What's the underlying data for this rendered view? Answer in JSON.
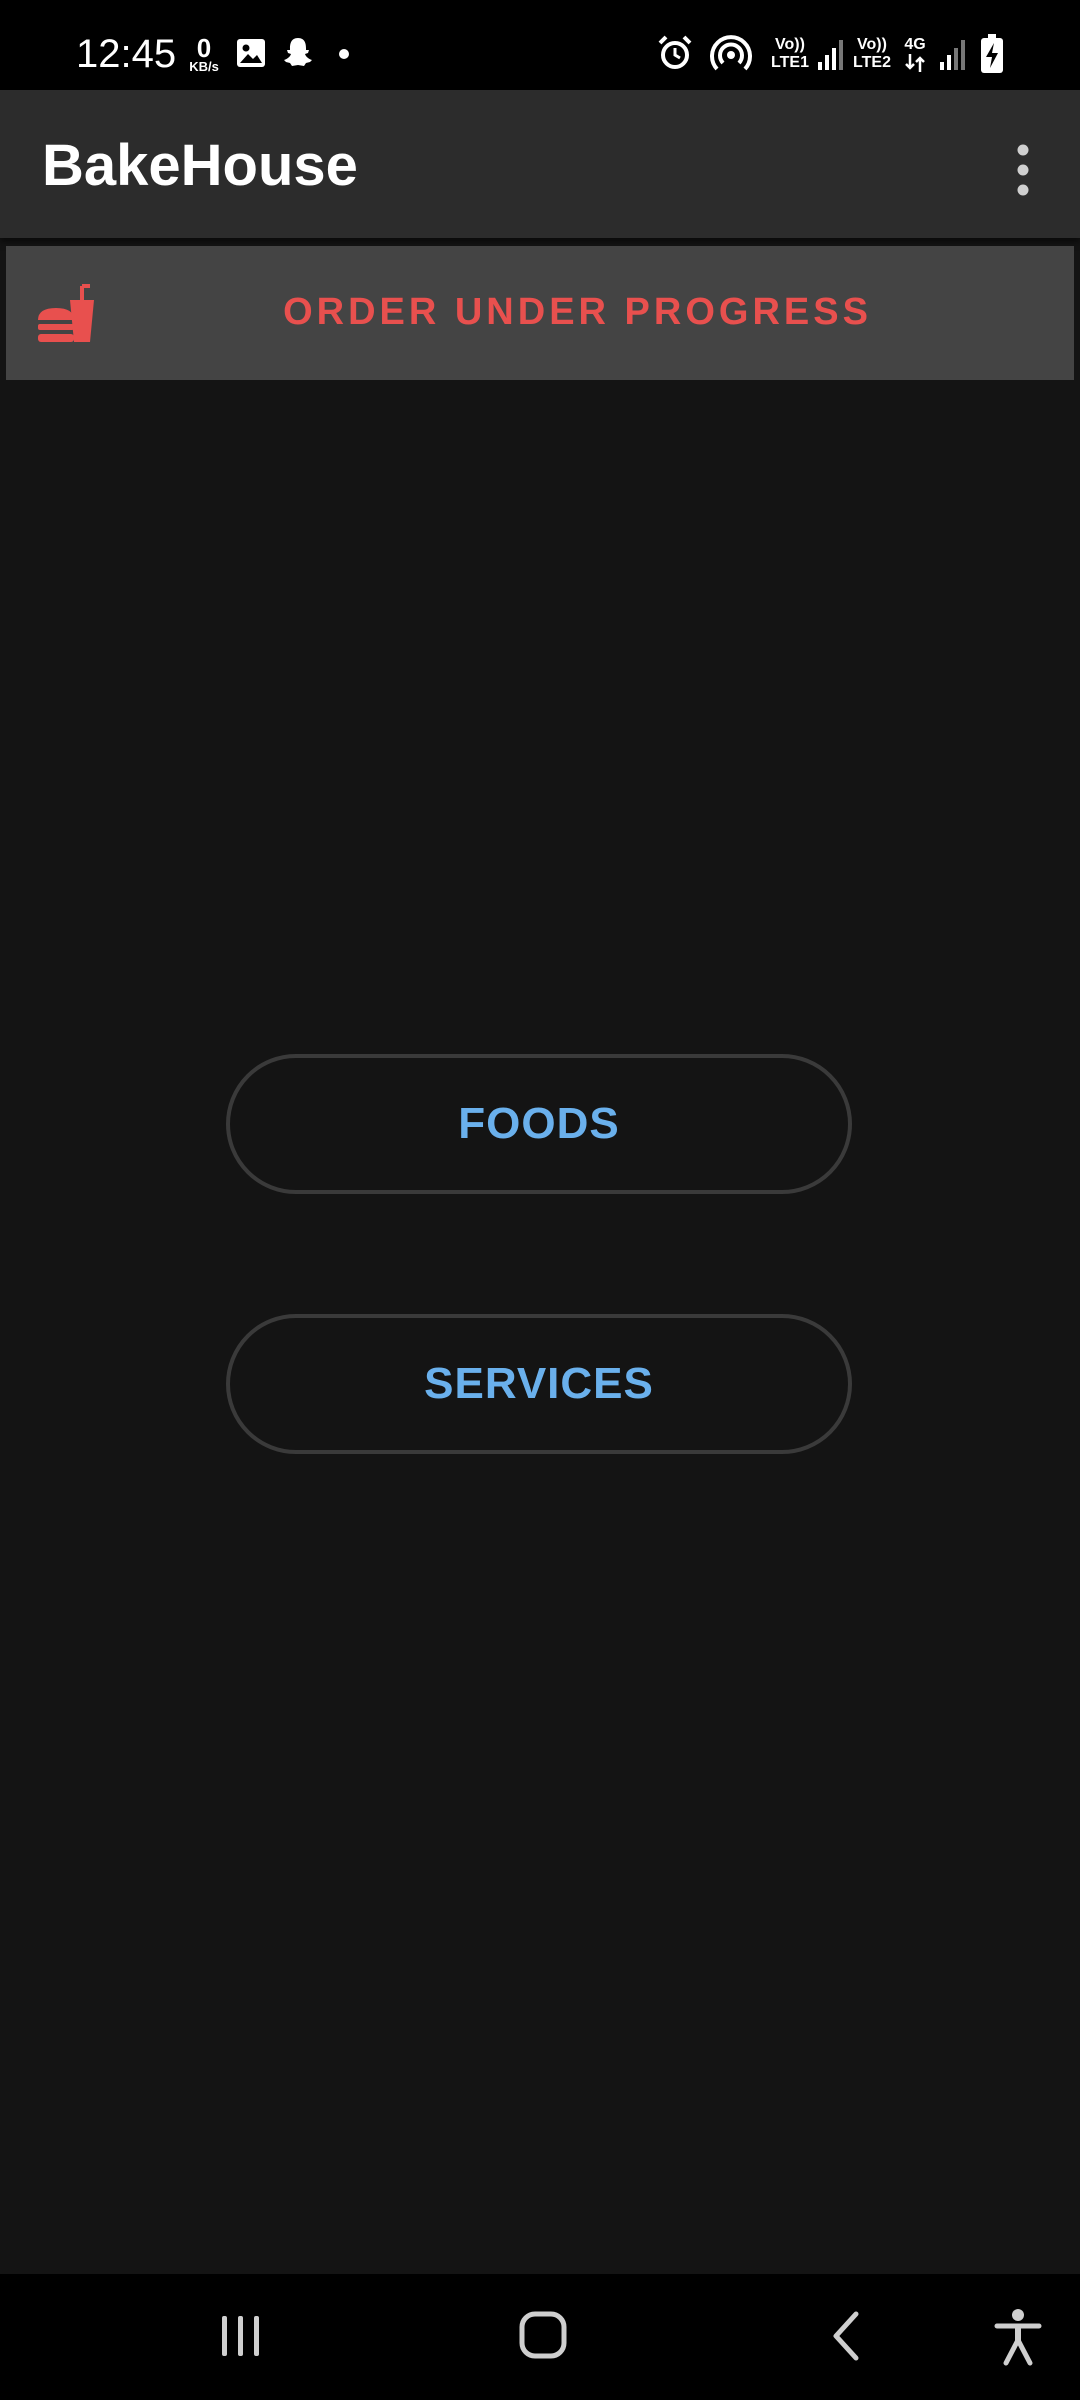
{
  "status_bar": {
    "time": "12:45",
    "net_speed_value": "0",
    "net_speed_unit": "KB/s",
    "sim1_label_top": "Vo))",
    "sim1_label_bottom": "LTE1",
    "sim2_label_top": "Vo))",
    "sim2_label_bottom": "LTE2",
    "network_type": "4G",
    "icons": [
      "gallery-icon",
      "snapchat-icon",
      "dot-icon",
      "alarm-icon",
      "hotspot-icon",
      "signal-icon",
      "signal-icon",
      "battery-charging-icon"
    ]
  },
  "app_bar": {
    "title": "BakeHouse",
    "menu_icon": "more-vert-icon"
  },
  "banner": {
    "icon": "fastfood-icon",
    "text": "ORDER UNDER PROGRESS"
  },
  "buttons": {
    "foods": "FOODS",
    "services": "SERVICES"
  },
  "nav_bar": {
    "icons": [
      "recent-apps-icon",
      "home-icon",
      "back-icon",
      "accessibility-icon"
    ]
  },
  "colors": {
    "accent_red": "#e8504e",
    "accent_blue": "#6ab0ec",
    "background": "#141414",
    "app_bar": "#2c2c2c",
    "banner": "#444444"
  }
}
